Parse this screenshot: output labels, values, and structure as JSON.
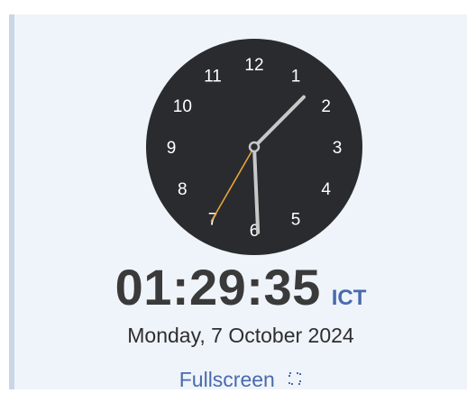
{
  "clock": {
    "numerals": [
      "12",
      "1",
      "2",
      "3",
      "4",
      "5",
      "6",
      "7",
      "8",
      "9",
      "10",
      "11"
    ],
    "hours": 1,
    "minutes": 29,
    "seconds": 35,
    "face_color": "#2a2b2e",
    "numeral_color": "#ffffff",
    "hand_color": "#c8c8c8",
    "second_hand_color": "#e8a33a"
  },
  "digital": {
    "time": "01:29:35",
    "timezone": "ICT"
  },
  "date": "Monday, 7 October 2024",
  "fullscreen_label": "Fullscreen",
  "icons": {
    "fullscreen": "fullscreen-icon"
  }
}
